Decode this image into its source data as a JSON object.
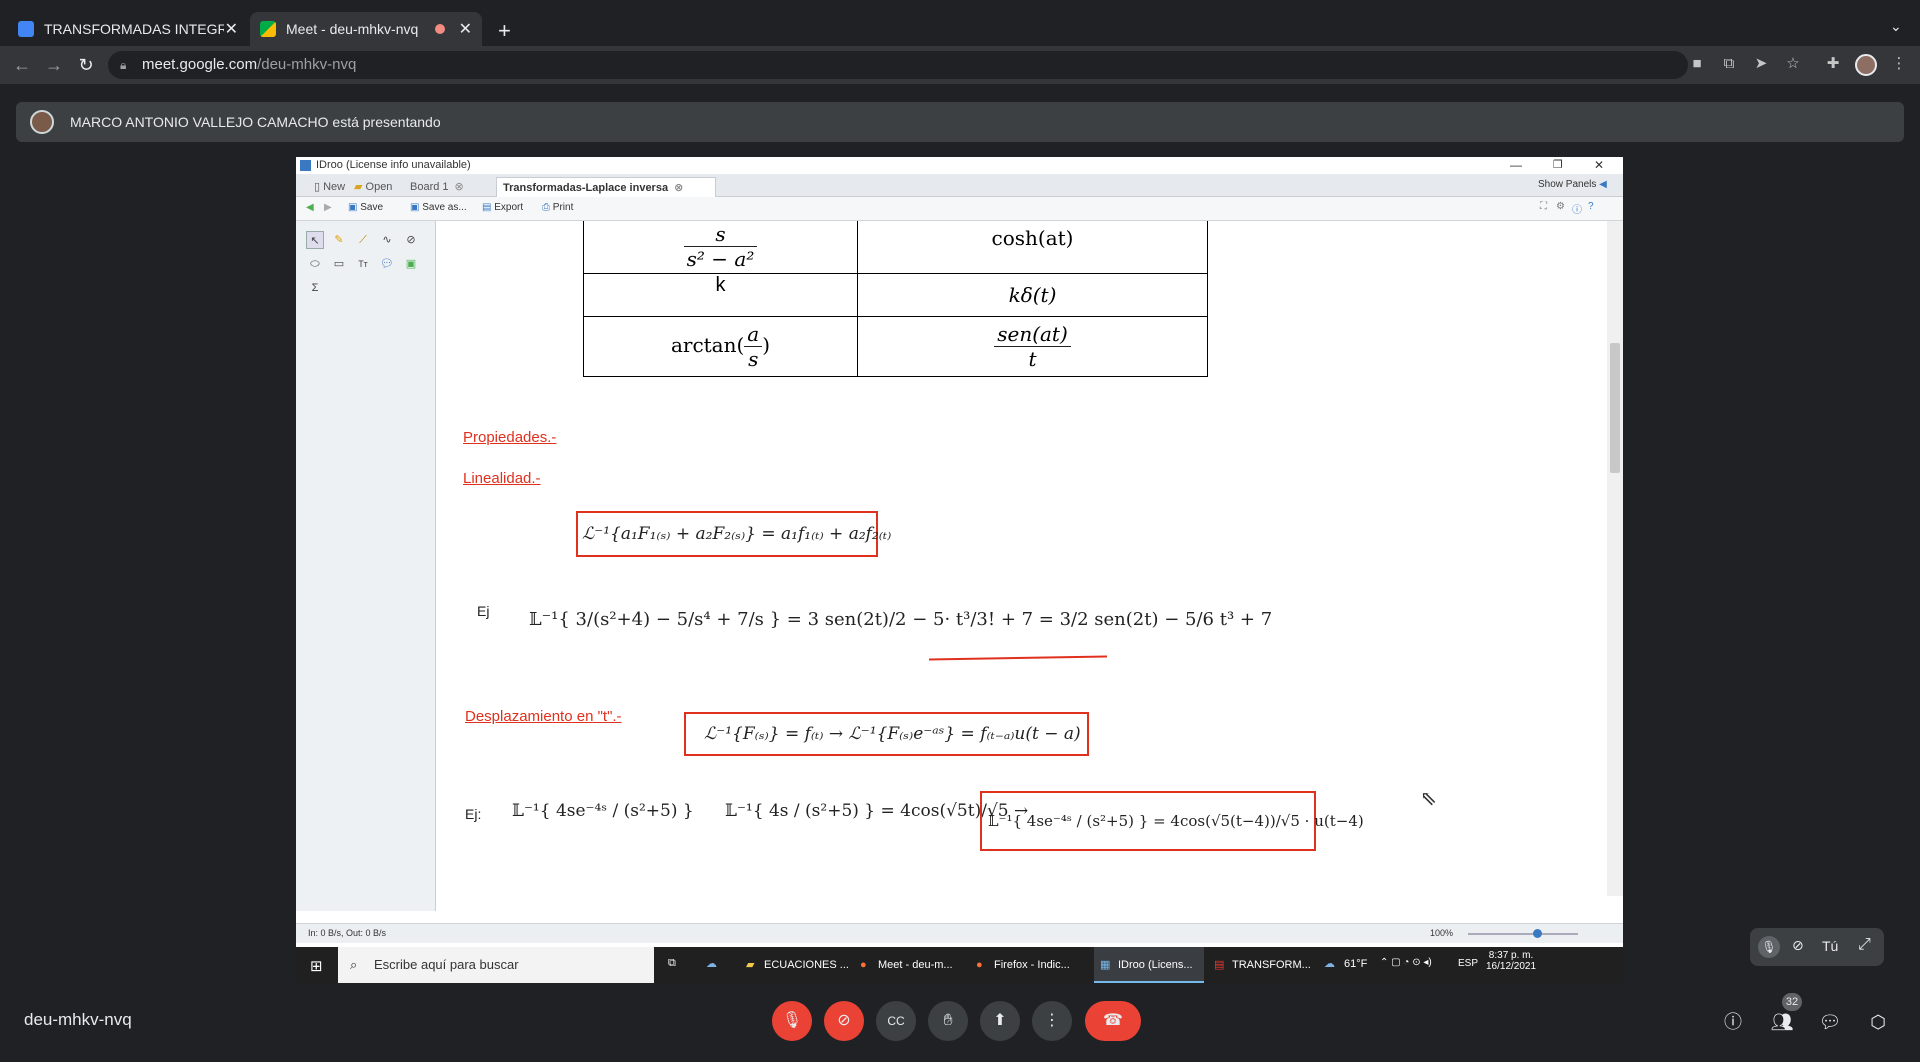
{
  "browser": {
    "tabs": [
      {
        "title": "TRANSFORMADAS INTEGRAL",
        "close": "✕"
      },
      {
        "title": "Meet - deu-mhkv-nvq",
        "close": "✕"
      }
    ],
    "new_tab": "+",
    "url_host": "meet.google.com",
    "url_path": "/deu-mhkv-nvq"
  },
  "presenter": {
    "text": "MARCO ANTONIO VALLEJO CAMACHO está presentando"
  },
  "idroo": {
    "window_title": "IDroo (License info unavailable)",
    "tabs": {
      "new": "New",
      "open": "Open",
      "board1": "Board 1",
      "current": "Transformadas-Laplace inversa"
    },
    "show_panels": "Show Panels",
    "toolbar": {
      "save": "Save",
      "save_as": "Save as...",
      "export": "Export",
      "print": "Print"
    },
    "status": "In: 0 B/s, Out: 0 B/s",
    "zoom": "100%",
    "content": {
      "table": {
        "r1_left_num": "s",
        "r1_left_den": "s² − a²",
        "r1_right": "cosh(at)",
        "r2_left": "k",
        "r2_right": "kδ(t)",
        "r3_left_fn": "arctan",
        "r3_left_num": "a",
        "r3_left_den": "s",
        "r3_right_num": "sen(at)",
        "r3_right_den": "t"
      },
      "propiedades": "Propiedades.-",
      "linealidad": "Linealidad.-",
      "linealidad_formula": "ℒ⁻¹{a₁F₁₍ₛ₎ + a₂F₂₍ₛ₎} = a₁f₁₍ₜ₎ + a₂f₂₍ₜ₎",
      "ej1_label": "Ej",
      "ej1_formula": "𝕃⁻¹{ 3/(s²+4) − 5/s⁴ + 7/s } = 3 sen(2t)/2 − 5· t³/3! + 7 = 3/2 sen(2t) − 5/6 t³ + 7",
      "desplazamiento": "Desplazamiento en \"t\".-",
      "desplazamiento_formula": "ℒ⁻¹{F₍ₛ₎} = f₍ₜ₎ → ℒ⁻¹{F₍ₛ₎e⁻ᵃˢ} = f₍ₜ₋ₐ₎u(t − a)",
      "ej2_label": "Ej:",
      "ej2_a": "𝕃⁻¹{ 4se⁻⁴ˢ / (s²+5) }",
      "ej2_b": "𝕃⁻¹{ 4s / (s²+5) } = 4cos(√5t)/√5 →",
      "ej2_c": "𝕃⁻¹{ 4se⁻⁴ˢ / (s²+5) } = 4cos(√5(t−4))/√5 · u(t−4)"
    }
  },
  "taskbar": {
    "search_placeholder": "Escribe aquí para buscar",
    "apps": [
      "ECUACIONES ...",
      "Meet - deu-m...",
      "Firefox - Indic...",
      "IDroo (Licens...",
      "TRANSFORM..."
    ],
    "weather": "61°F",
    "lang": "ESP",
    "time": "8:37 p. m.",
    "date": "16/12/2021"
  },
  "meet": {
    "meeting_code": "deu-mhkv-nvq",
    "self_label": "Tú",
    "participants_count": "32"
  }
}
